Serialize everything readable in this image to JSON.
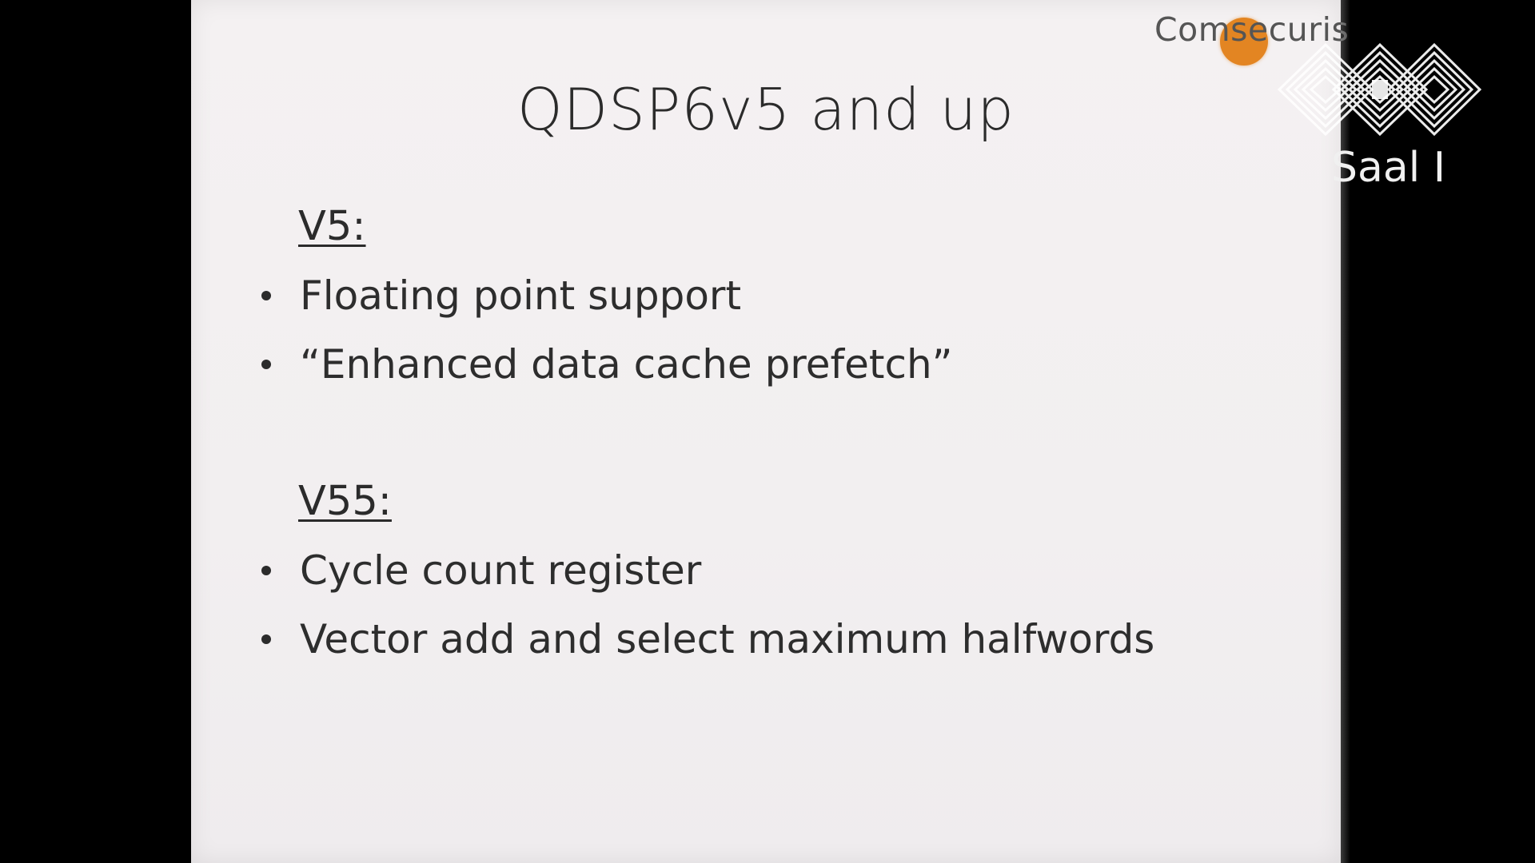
{
  "slide": {
    "title": "QDSP6v5 and up",
    "sections": [
      {
        "heading": "V5:",
        "bullets": [
          "Floating point support",
          "“Enhanced data cache prefetch”"
        ]
      },
      {
        "heading": "V55:",
        "bullets": [
          "Cycle count register",
          "Vector add and select maximum halfwords"
        ]
      }
    ]
  },
  "brand": {
    "name": "Comsecuris",
    "accent_color": "#e38522"
  },
  "overlay": {
    "logo_icon": "ccc-logo-icon",
    "room_label": "Saal I"
  }
}
